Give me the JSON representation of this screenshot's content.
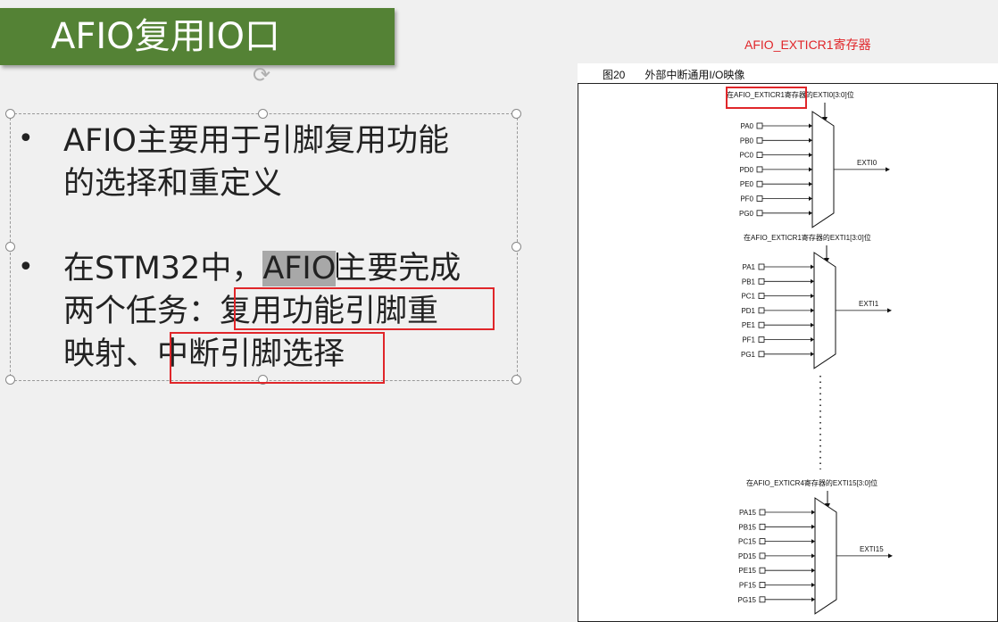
{
  "slide": {
    "title": "AFIO复用IO口",
    "bullet1_line1": "AFIO主要用于引脚复用功能",
    "bullet1_line2": "的选择和重定义",
    "bullet2_line1_a": "在STM32中，",
    "bullet2_line1_hl": "AFIO",
    "bullet2_line1_b": "主要完成",
    "bullet2_line2_a": "两个任务：",
    "bullet2_line2_boxed": "复用功能引脚重",
    "bullet2_line3_a": "映射、",
    "bullet2_line3_boxed": "中断引脚选择",
    "bullet_symbol": "•"
  },
  "annotation": {
    "label": "AFIO_EXTICR1寄存器",
    "color": "#e0262a"
  },
  "figure": {
    "number": "图20",
    "title": "外部中断通用I/O映像",
    "groups": [
      {
        "header_reg": "在AFIO_EXTICR1",
        "header_rest": "寄存器的EXTI0[3:0]位",
        "inputs": [
          "PA0",
          "PB0",
          "PC0",
          "PD0",
          "PE0",
          "PF0",
          "PG0"
        ],
        "output": "EXTI0"
      },
      {
        "header_reg": "在AFIO_EXTICR1",
        "header_rest": "寄存器的EXTI1[3:0]位",
        "inputs": [
          "PA1",
          "PB1",
          "PC1",
          "PD1",
          "PE1",
          "PF1",
          "PG1"
        ],
        "output": "EXTI1"
      },
      {
        "header_reg": "在AFIO_EXTICR4",
        "header_rest": "寄存器的EXTI15[3:0]位",
        "inputs": [
          "PA15",
          "PB15",
          "PC15",
          "PD15",
          "PE15",
          "PF15",
          "PG15"
        ],
        "output": "EXTI15"
      }
    ]
  },
  "colors": {
    "title_bg": "#548235",
    "highlight_box": "#e0262a",
    "slide_bg": "#f0f0f0"
  }
}
